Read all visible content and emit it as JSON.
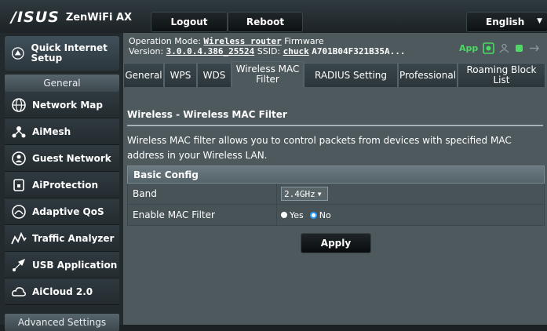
{
  "header": {
    "logo": "/ISUS",
    "product": "ZenWiFi AX",
    "logout_label": "Logout",
    "reboot_label": "Reboot",
    "language": "English"
  },
  "sidebar": {
    "quick_setup": "Quick Internet Setup",
    "general_label": "General",
    "items": [
      {
        "label": "Network Map",
        "icon": "globe-icon"
      },
      {
        "label": "AiMesh",
        "icon": "mesh-icon"
      },
      {
        "label": "Guest Network",
        "icon": "guest-network-icon"
      },
      {
        "label": "AiProtection",
        "icon": "lock-icon"
      },
      {
        "label": "Adaptive QoS",
        "icon": "gauge-icon"
      },
      {
        "label": "Traffic Analyzer",
        "icon": "traffic-icon"
      },
      {
        "label": "USB Application",
        "icon": "usb-icon"
      },
      {
        "label": "AiCloud 2.0",
        "icon": "cloud-icon"
      }
    ],
    "advanced_label": "Advanced Settings"
  },
  "status": {
    "op_mode_label": "Operation Mode:",
    "op_mode": "Wireless router",
    "firmware_label": "Firmware",
    "version_label": "Version:",
    "version": "3.0.0.4.386_25524",
    "ssid_label": "SSID:",
    "ssid": "chuck",
    "mac": "A701B04F321B35A...",
    "app_label": "App"
  },
  "tabs": [
    "General",
    "WPS",
    "WDS",
    "Wireless MAC Filter",
    "RADIUS Setting",
    "Professional",
    "Roaming Block List"
  ],
  "page": {
    "title": "Wireless - Wireless MAC Filter",
    "description": "Wireless MAC filter allows you to control packets from devices with specified MAC address in your Wireless LAN."
  },
  "config": {
    "section_title": "Basic Config",
    "band_label": "Band",
    "band_value": "2.4GHz",
    "enable_label": "Enable MAC Filter",
    "yes_label": "Yes",
    "no_label": "No",
    "enabled": false
  },
  "apply_label": "Apply",
  "colors": {
    "accent": "#4cd964",
    "selected_radio": "#2e9bff"
  }
}
